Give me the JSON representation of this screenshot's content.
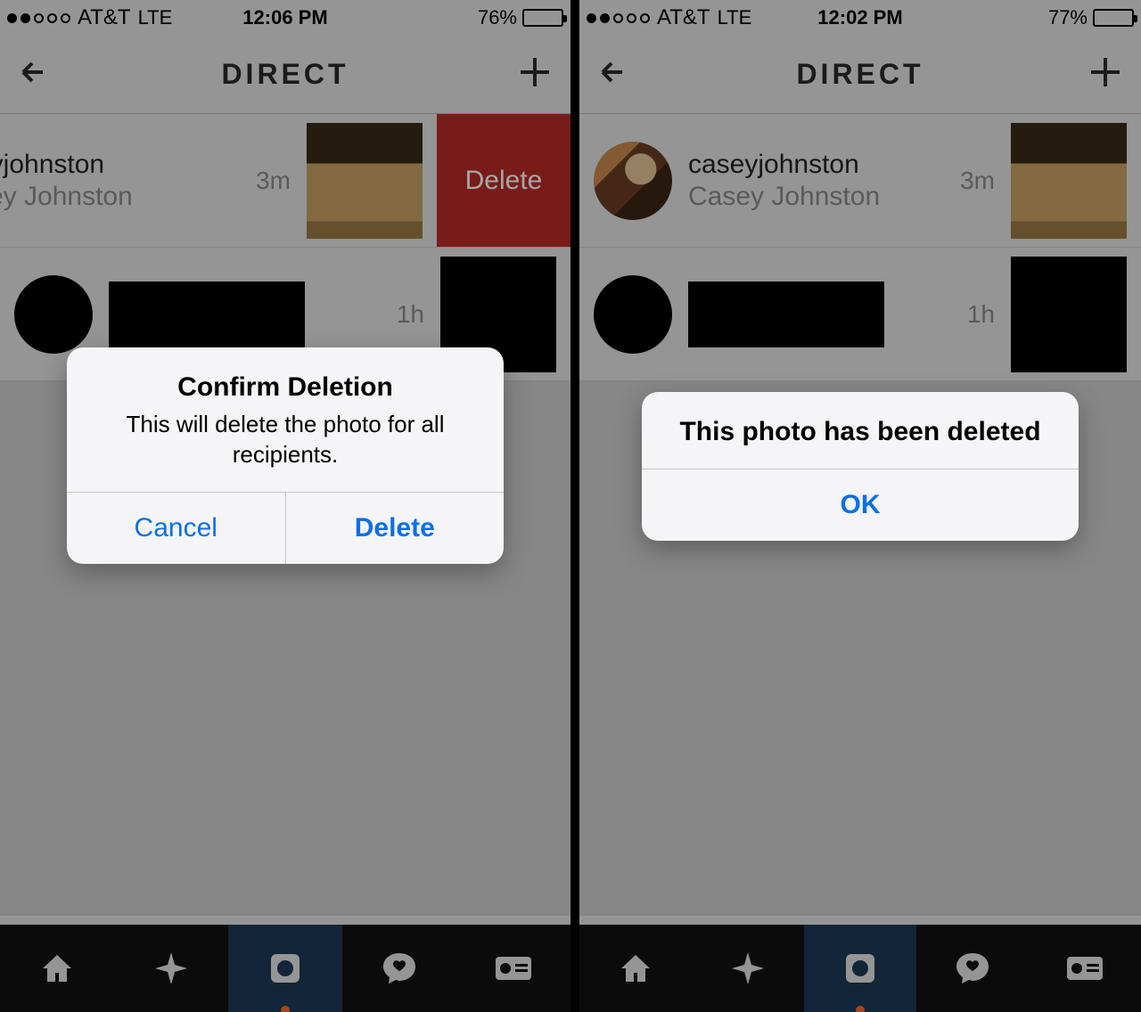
{
  "left": {
    "status": {
      "carrier": "AT&T",
      "net": "LTE",
      "time": "12:06 PM",
      "battery_pct": "76%",
      "battery_fill": 76
    },
    "nav": {
      "title": "DIRECT"
    },
    "rows": [
      {
        "username": "eyjohnston",
        "fullname": "sey Johnston",
        "time": "3m",
        "swipe_delete": "Delete",
        "redacted": false,
        "shifted": true
      },
      {
        "username": "",
        "fullname": "",
        "time": "1h",
        "redacted": true,
        "shifted": false
      }
    ],
    "alert": {
      "title": "Confirm Deletion",
      "message": "This will delete the photo for all recipients.",
      "buttons": [
        {
          "label": "Cancel",
          "bold": false
        },
        {
          "label": "Delete",
          "bold": true
        }
      ]
    }
  },
  "right": {
    "status": {
      "carrier": "AT&T",
      "net": "LTE",
      "time": "12:02 PM",
      "battery_pct": "77%",
      "battery_fill": 77
    },
    "nav": {
      "title": "DIRECT"
    },
    "rows": [
      {
        "username": "caseyjohnston",
        "fullname": "Casey Johnston",
        "time": "3m",
        "redacted": false,
        "shifted": false
      },
      {
        "username": "",
        "fullname": "",
        "time": "1h",
        "redacted": true,
        "shifted": false
      }
    ],
    "alert": {
      "title": "This photo has been deleted",
      "buttons": [
        {
          "label": "OK",
          "bold": true
        }
      ]
    }
  },
  "tabs": [
    "home",
    "explore",
    "camera",
    "activity",
    "profile"
  ]
}
